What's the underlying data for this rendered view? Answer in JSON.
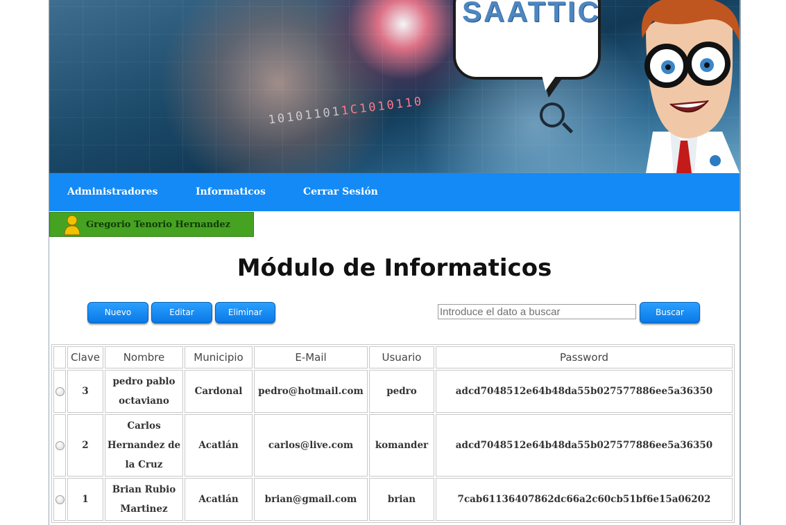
{
  "banner": {
    "logo_text": "SAATTIC",
    "binary_text_a": "10101101",
    "binary_text_b": "1C1010110"
  },
  "nav": {
    "items": [
      {
        "label": "Administradores"
      },
      {
        "label": "Informaticos"
      },
      {
        "label": "Cerrar Sesión"
      }
    ]
  },
  "user": {
    "name": "Gregorio Tenorio Hernandez"
  },
  "main": {
    "title": "Módulo de Informaticos"
  },
  "toolbar": {
    "new_label": "Nuevo",
    "edit_label": "Editar",
    "delete_label": "Eliminar",
    "search_placeholder": "Introduce el dato a buscar",
    "search_label": "Buscar"
  },
  "table": {
    "headers": [
      "Clave",
      "Nombre",
      "Municipio",
      "E-Mail",
      "Usuario",
      "Password"
    ],
    "rows": [
      {
        "clave": "3",
        "nombre": "pedro pablo octaviano",
        "municipio": "Cardonal",
        "email": "pedro@hotmail.com",
        "usuario": "pedro",
        "password": "adcd7048512e64b48da55b027577886ee5a36350"
      },
      {
        "clave": "2",
        "nombre": "Carlos Hernandez de la Cruz",
        "municipio": "Acatlán",
        "email": "carlos@live.com",
        "usuario": "komander",
        "password": "adcd7048512e64b48da55b027577886ee5a36350"
      },
      {
        "clave": "1",
        "nombre": "Brian Rubio Martinez",
        "municipio": "Acatlán",
        "email": "brian@gmail.com",
        "usuario": "brian",
        "password": "7cab61136407862dc66a2c60cb51bf6e15a06202"
      }
    ]
  },
  "colors": {
    "nav_bg": "#138af5",
    "button_bg": "#138af5",
    "user_badge_bg": "#46a322",
    "logo_text": "#4d86c1"
  },
  "icons": {
    "user": "user-icon",
    "magnifier": "magnifier-icon",
    "radio": "radio-icon"
  }
}
